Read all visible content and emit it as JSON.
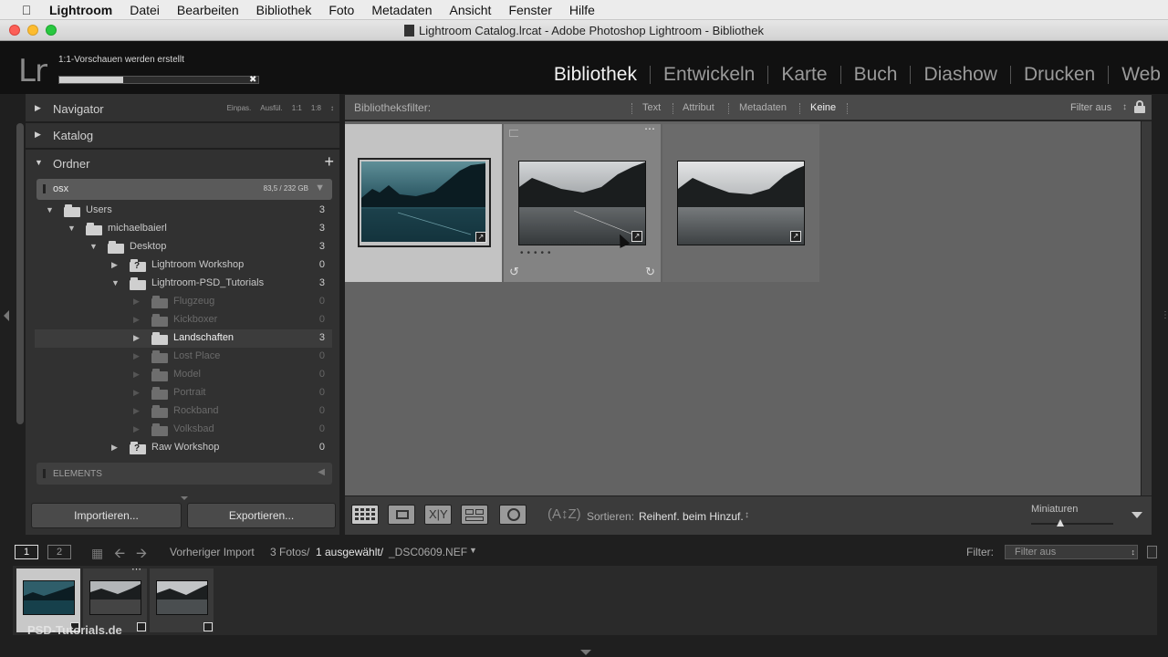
{
  "menubar": {
    "app": "Lightroom",
    "items": [
      "Datei",
      "Bearbeiten",
      "Bibliothek",
      "Foto",
      "Metadaten",
      "Ansicht",
      "Fenster",
      "Hilfe"
    ]
  },
  "window": {
    "title": "Lightroom Catalog.lrcat - Adobe Photoshop Lightroom - Bibliothek"
  },
  "identity": {
    "logo": "Lr",
    "progress_label": "1:1-Vorschauen werden erstellt",
    "progress_fraction": 0.32
  },
  "modules": [
    "Bibliothek",
    "Entwickeln",
    "Karte",
    "Buch",
    "Diashow",
    "Drucken",
    "Web"
  ],
  "active_module": "Bibliothek",
  "left_panel": {
    "navigator": {
      "label": "Navigator",
      "options": [
        "Einpas.",
        "Ausfül.",
        "1:1",
        "1:8"
      ]
    },
    "katalog": {
      "label": "Katalog"
    },
    "ordner": {
      "label": "Ordner",
      "add_symbol": "+",
      "volume": {
        "name": "osx",
        "size": "83,5 / 232 GB"
      },
      "folders": [
        {
          "name": "Users",
          "count": "3",
          "expanded": true,
          "dim": false
        },
        {
          "name": "michaelbaierl",
          "count": "3",
          "expanded": true,
          "dim": false
        },
        {
          "name": "Desktop",
          "count": "3",
          "expanded": true,
          "dim": false
        },
        {
          "name": "Lightroom Workshop",
          "count": "0",
          "expanded": false,
          "dim": false,
          "missing": true
        },
        {
          "name": "Lightroom-PSD_Tutorials",
          "count": "3",
          "expanded": true,
          "dim": false
        },
        {
          "name": "Flugzeug",
          "count": "0",
          "dim": true
        },
        {
          "name": "Kickboxer",
          "count": "0",
          "dim": true
        },
        {
          "name": "Landschaften",
          "count": "3",
          "dim": false,
          "selected": true
        },
        {
          "name": "Lost Place",
          "count": "0",
          "dim": true
        },
        {
          "name": "Model",
          "count": "0",
          "dim": true
        },
        {
          "name": "Portrait",
          "count": "0",
          "dim": true
        },
        {
          "name": "Rockband",
          "count": "0",
          "dim": true
        },
        {
          "name": "Volksbad",
          "count": "0",
          "dim": true
        },
        {
          "name": "Raw Workshop",
          "count": "0",
          "expanded": false,
          "dim": false,
          "missing": true
        }
      ],
      "elements_label": "ELEMENTS"
    },
    "import_label": "Importieren...",
    "export_label": "Exportieren..."
  },
  "filter_bar": {
    "label": "Bibliotheksfilter:",
    "options": [
      "Text",
      "Attribut",
      "Metadaten",
      "Keine"
    ],
    "active": "Keine",
    "preset": "Filter aus"
  },
  "toolbar": {
    "sort_label": "Sortieren:",
    "sort_value": "Reihenf. beim Hinzuf.",
    "thumb_label": "Miniaturen",
    "thumb_size": 0.35
  },
  "filmstrip_bar": {
    "screen1": "1",
    "screen2": "2",
    "source": "Vorheriger Import",
    "count": "3 Fotos/",
    "selected": "1 ausgewählt/",
    "filename": "_DSC0609.NEF",
    "filter_label": "Filter:",
    "filter_value": "Filter aus"
  },
  "watermark": "PSD-Tutorials.de",
  "colors": {
    "active_module": "#f2f2f2",
    "selected_cell": "#c3c3c3",
    "grid_bg": "#636363"
  }
}
